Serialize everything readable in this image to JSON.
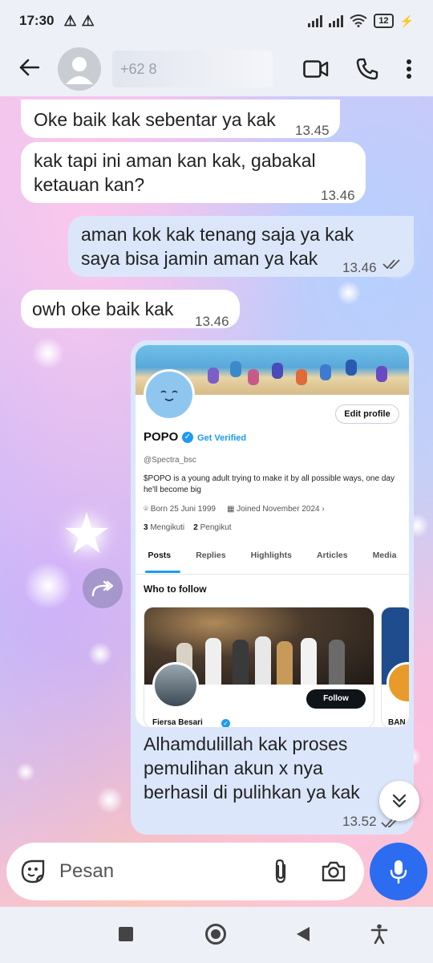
{
  "status_bar": {
    "time": "17:30",
    "battery": "12"
  },
  "chat_header": {
    "contact_name": "+62 8"
  },
  "messages": [
    {
      "id": "m1",
      "direction": "in",
      "text": "Oke baik kak sebentar ya kak",
      "time": "13.45"
    },
    {
      "id": "m2",
      "direction": "in",
      "text": "kak tapi ini aman kan kak, gabakal ketauan kan?",
      "time": "13.46"
    },
    {
      "id": "m3",
      "direction": "out",
      "text": "aman kok kak tenang saja ya kak saya bisa jamin aman ya kak",
      "time": "13.46",
      "read": true
    },
    {
      "id": "m4",
      "direction": "in",
      "text": "owh oke baik kak",
      "time": "13.46"
    }
  ],
  "image_message": {
    "caption": "Alhamdulillah kak proses pemulihan akun x nya berhasil di pulihkan ya kak",
    "time": "13.52",
    "screenshot": {
      "edit_profile": "Edit profile",
      "profile_name": "POPO",
      "get_verified": "Get Verified",
      "handle": "@Spectra_bsc",
      "bio": "$POPO is a young adult trying to make it by all possible ways, one day he'll become big",
      "born": "Born 25 Juni 1999",
      "joined": "Joined November 2024",
      "following_count": "3",
      "following_label": "Mengikuti",
      "followers_count": "2",
      "followers_label": "Pengikut",
      "tabs": [
        "Posts",
        "Replies",
        "Highlights",
        "Articles",
        "Media"
      ],
      "who_to_follow": "Who to follow",
      "suggestion_name": "Fiersa Besari",
      "follow_label": "Follow",
      "suggestion2_name": "BAN"
    }
  },
  "composer": {
    "placeholder": "Pesan"
  },
  "colors": {
    "accent": "#2c6cf0",
    "outgoing_bubble": "#dbe6fb",
    "incoming_bubble": "#ffffff",
    "twitter_blue": "#1d9bf0"
  }
}
